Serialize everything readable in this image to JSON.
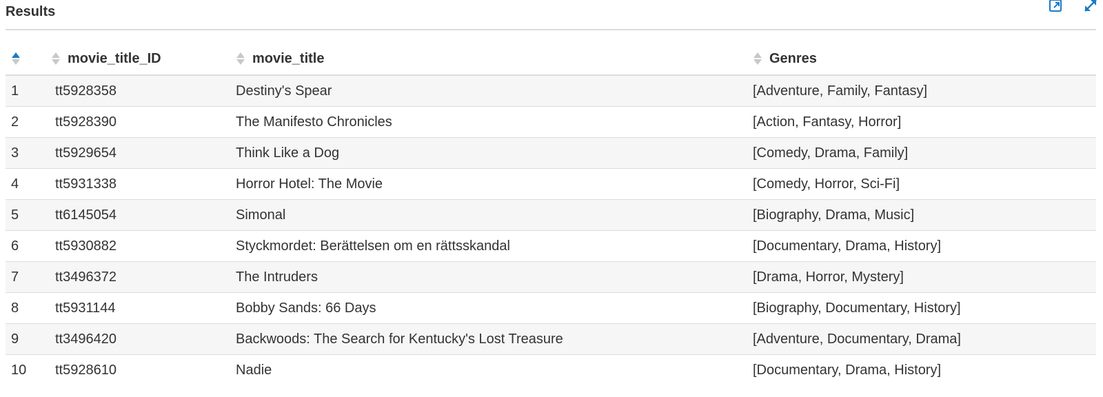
{
  "panel": {
    "title": "Results",
    "icons": {
      "popout": "popout-icon",
      "expand": "expand-icon"
    }
  },
  "colors": {
    "accent": "#1a7bc5",
    "sort_inactive": "#c8c8c8",
    "row_stripe": "#f6f6f6",
    "border": "#dcdcdc"
  },
  "table": {
    "sorted_column": "index",
    "sort_direction": "ascending",
    "columns": [
      {
        "key": "index",
        "label": ""
      },
      {
        "key": "movie_title_ID",
        "label": "movie_title_ID"
      },
      {
        "key": "movie_title",
        "label": "movie_title"
      },
      {
        "key": "Genres",
        "label": "Genres"
      }
    ],
    "rows": [
      {
        "index": "1",
        "id": "tt5928358",
        "title": "Destiny's Spear",
        "genres": "[Adventure, Family, Fantasy]"
      },
      {
        "index": "2",
        "id": "tt5928390",
        "title": "The Manifesto Chronicles",
        "genres": "[Action, Fantasy, Horror]"
      },
      {
        "index": "3",
        "id": "tt5929654",
        "title": "Think Like a Dog",
        "genres": "[Comedy, Drama, Family]"
      },
      {
        "index": "4",
        "id": "tt5931338",
        "title": "Horror Hotel: The Movie",
        "genres": "[Comedy, Horror, Sci-Fi]"
      },
      {
        "index": "5",
        "id": "tt6145054",
        "title": "Simonal",
        "genres": "[Biography, Drama, Music]"
      },
      {
        "index": "6",
        "id": "tt5930882",
        "title": "Styckmordet: Berättelsen om en rättsskandal",
        "genres": "[Documentary, Drama, History]"
      },
      {
        "index": "7",
        "id": "tt3496372",
        "title": "The Intruders",
        "genres": "[Drama, Horror, Mystery]"
      },
      {
        "index": "8",
        "id": "tt5931144",
        "title": "Bobby Sands: 66 Days",
        "genres": "[Biography, Documentary, History]"
      },
      {
        "index": "9",
        "id": "tt3496420",
        "title": "Backwoods: The Search for Kentucky's Lost Treasure",
        "genres": "[Adventure, Documentary, Drama]"
      },
      {
        "index": "10",
        "id": "tt5928610",
        "title": "Nadie",
        "genres": "[Documentary, Drama, History]"
      }
    ]
  }
}
